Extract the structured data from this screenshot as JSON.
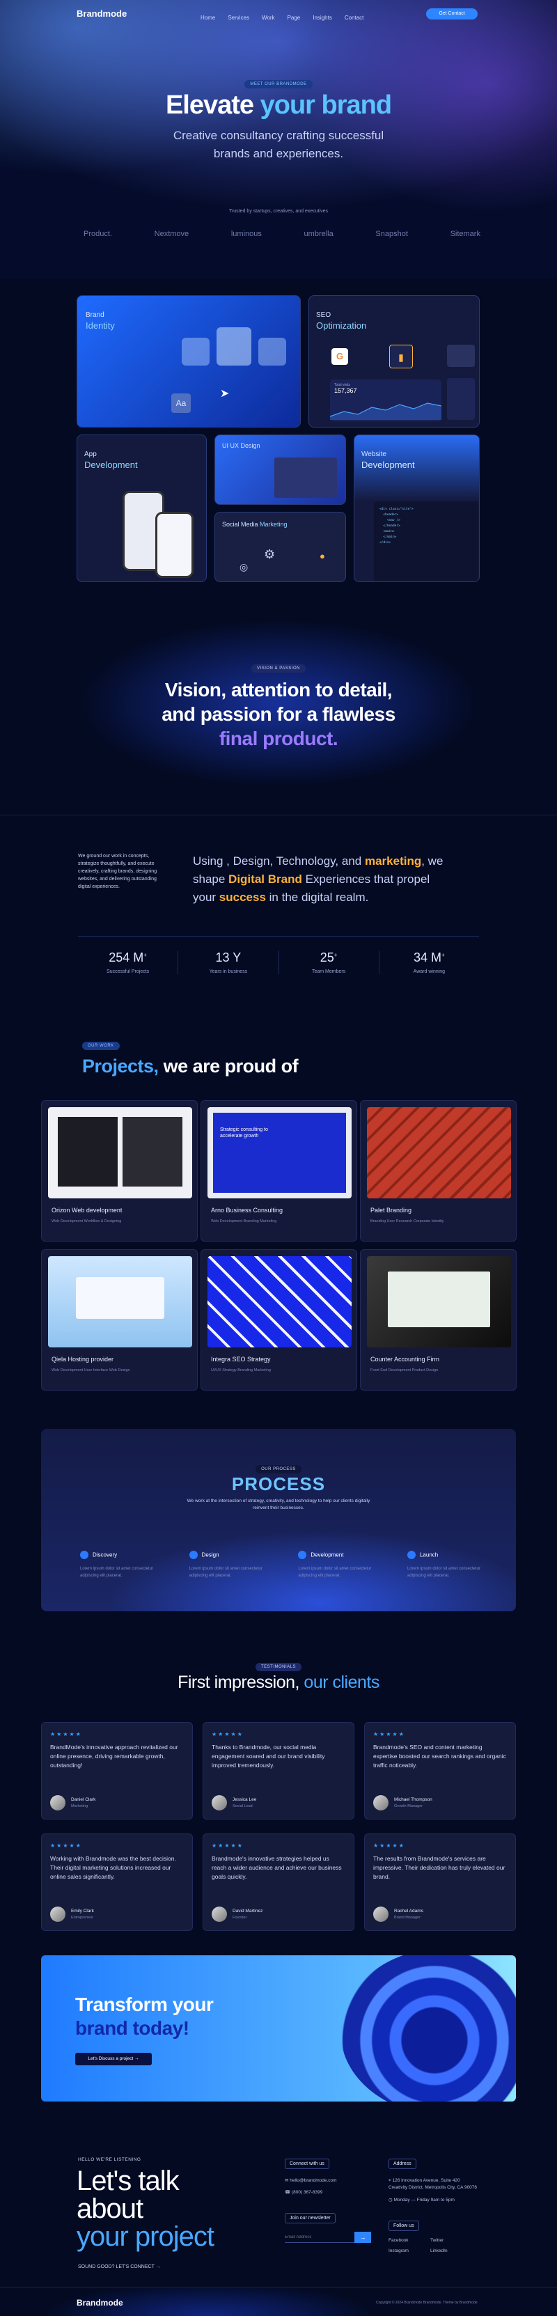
{
  "brand": {
    "name": "Brandmode"
  },
  "nav": {
    "items": [
      "Home",
      "Services",
      "Work",
      "Page",
      "Insights",
      "Contact"
    ],
    "cta": "Get Contact"
  },
  "hero": {
    "badge": "MEET OUR BRANDMODE",
    "title_a": "Elevate ",
    "title_b": "your brand",
    "subtitle_1": "Creative consultancy crafting successful",
    "subtitle_2": "brands and experiences.",
    "trusted": "Trusted by startups, creatives, and executives",
    "logos": [
      "Product.",
      "Nextmove",
      "luminous",
      "umbrella",
      "Snapshot",
      "Sitemark"
    ]
  },
  "services": {
    "brand": {
      "a": "Brand",
      "b": "Identity"
    },
    "seo": {
      "a": "SEO",
      "b": "Optimization",
      "metric": "157,367"
    },
    "app": {
      "a": "App",
      "b": "Development"
    },
    "ux": "UI UX Design",
    "social": {
      "a": "Social Media",
      "b": "Marketing"
    },
    "web": {
      "a": "Website",
      "b": "Development"
    }
  },
  "vision": {
    "badge": "VISION & PASSION",
    "l1": "Vision, attention to detail,",
    "l2": "and passion for a flawless",
    "l3": "final product."
  },
  "about": {
    "left": "We ground our work in concepts, strategize thoughtfully, and execute creatively, crafting brands, designing websites, and delivering outstanding digital experiences.",
    "r1": "Using , Design, Technology, and ",
    "r1b": "marketing",
    "r1c": ", we",
    "r2": "shape ",
    "r2b": "Digital Brand",
    "r2c": " Experiences that propel",
    "r3": "your ",
    "r3b": "success",
    "r3c": " in the digital realm."
  },
  "stats": [
    {
      "n": "254 M",
      "s": "+",
      "l": "Successful Projects"
    },
    {
      "n": "13 Y",
      "s": "",
      "l": "Years in business"
    },
    {
      "n": "25",
      "s": "+",
      "l": "Team Members"
    },
    {
      "n": "34 M",
      "s": "+",
      "l": "Award winning"
    }
  ],
  "projects": {
    "badge": "OUR WORK",
    "title_a": "Projects,",
    "title_b": " we are proud of",
    "items": [
      {
        "t": "Orizon Web development",
        "g": "Web Development    Workflow & Designing"
      },
      {
        "t": "Arno Business Consulting",
        "g": "Web Development    Branding    Marketing"
      },
      {
        "t": "Palet Branding",
        "g": "Branding    User Research    Corporate Identity"
      },
      {
        "t": "Qiela Hosting provider",
        "g": "Web Development    User Interface    Web Design"
      },
      {
        "t": "Integra SEO Strategy",
        "g": "UI/UX Strategy    Branding    Marketing"
      },
      {
        "t": "Counter Accounting Firm",
        "g": "Front End Development    Product Design"
      }
    ],
    "hero_card": "Strategic consulting to accelerate growth"
  },
  "process": {
    "badge": "OUR PROCESS",
    "title": "PROCESS",
    "desc": "We work at the intersection of strategy, creativity, and technology to help our clients digitally reinvent their businesses.",
    "steps": [
      {
        "h": "Discovery",
        "p": "Lorem ipsum dolor sit amet consectetur adipiscing elit placerat."
      },
      {
        "h": "Design",
        "p": "Lorem ipsum dolor sit amet consectetur adipiscing elit placerat."
      },
      {
        "h": "Development",
        "p": "Lorem ipsum dolor sit amet consectetur adipiscing elit placerat."
      },
      {
        "h": "Launch",
        "p": "Lorem ipsum dolor sit amet consectetur adipiscing elit placerat."
      }
    ]
  },
  "testimonials": {
    "badge": "TESTIMONIALS",
    "title_a": "First impression, ",
    "title_b": "our clients",
    "stars": "★★★★★",
    "items": [
      {
        "q": "BrandMode's innovative approach revitalized our online presence, driving remarkable growth, outstanding!",
        "n": "Daniel Clark",
        "r": "Marketing"
      },
      {
        "q": "Thanks to Brandmode, our social media engagement soared and our brand visibility improved tremendously.",
        "n": "Jessica Lee",
        "r": "Social Lead"
      },
      {
        "q": "Brandmode's SEO and content marketing expertise boosted our search rankings and organic traffic noticeably.",
        "n": "Michael Thompson",
        "r": "Growth Manager"
      },
      {
        "q": "Working with Brandmode was the best decision. Their digital marketing solutions increased our online sales significantly.",
        "n": "Emily Clark",
        "r": "Entrepreneur"
      },
      {
        "q": "Brandmode's innovative strategies helped us reach a wider audience and achieve our business goals quickly.",
        "n": "David Martinez",
        "r": "Founder"
      },
      {
        "q": "The results from Brandmode's services are impressive. Their dedication has truly elevated our brand.",
        "n": "Rachel Adams",
        "r": "Brand Manager"
      }
    ]
  },
  "cta": {
    "l1": "Transform your",
    "l2": "brand today!",
    "button": "Let's Discuss a project →"
  },
  "contact": {
    "kicker": "HELLO WE'RE LISTENING",
    "l1": "Let's talk",
    "l2": "about",
    "l3": "your project",
    "sound": "SOUND GOOD? LET'S CONNECT →",
    "connect_h": "Connect with us",
    "email": "hello@brandmode.com",
    "phone": "(800) 367-8399",
    "news_h": "Join our newsletter",
    "news_ph": "Email Address",
    "address_h": "Address",
    "addr1": "126 Innovation Avenue, Suite 420",
    "addr2": "Creativity District, Metropolis City, CA 90076",
    "hours": "Monday — Friday 9am to 5pm",
    "follow_h": "Follow us",
    "social": [
      "Facebook",
      "Twitter",
      "Instagram",
      "LinkedIn"
    ]
  },
  "footer": {
    "copy": "Copyright © 2024 Brandmode Brandmode. Theme by Brandmode"
  }
}
